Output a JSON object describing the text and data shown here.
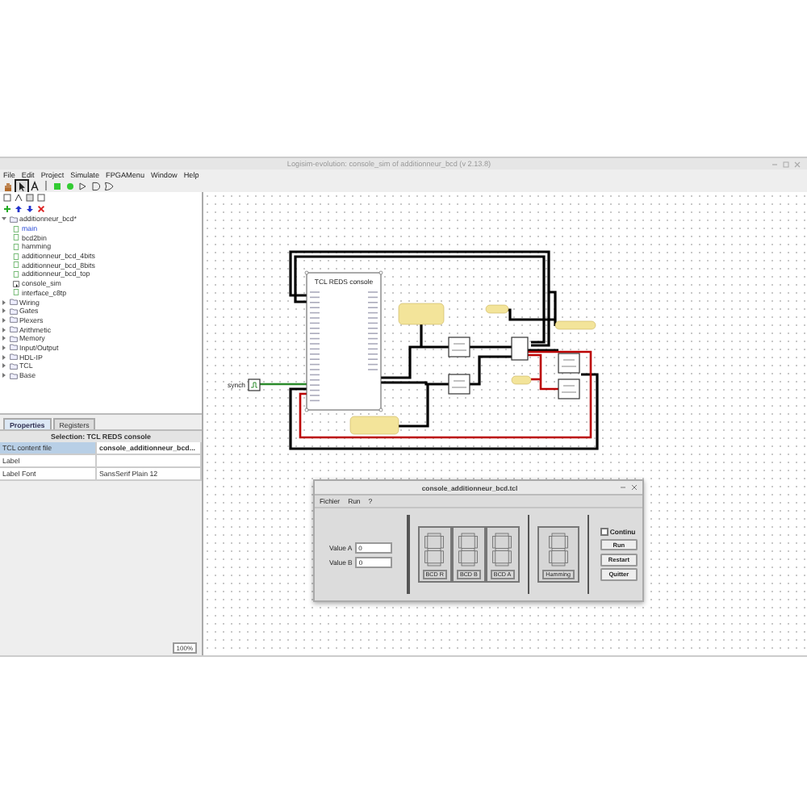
{
  "window": {
    "title": "Logisim-evolution: console_sim of additionneur_bcd (v 2.13.8)"
  },
  "menu": [
    "File",
    "Edit",
    "Project",
    "Simulate",
    "FPGAMenu",
    "Window",
    "Help"
  ],
  "tools": [
    {
      "kind": "hand",
      "selected": false
    },
    {
      "kind": "pointer",
      "selected": true
    },
    {
      "kind": "text",
      "selected": false
    },
    {
      "kind": "input",
      "selected": false
    },
    {
      "kind": "output",
      "selected": false
    },
    {
      "kind": "not",
      "selected": false
    },
    {
      "kind": "and",
      "selected": false
    },
    {
      "kind": "or",
      "selected": false
    }
  ],
  "tree": {
    "label": "additionneur_bcd*",
    "expanded": true,
    "children": [
      {
        "label": "main",
        "kind": "circuit",
        "selected": true
      },
      {
        "label": "bcd2bin",
        "kind": "circuit",
        "selected": false
      },
      {
        "label": "hamming",
        "kind": "circuit",
        "selected": false
      },
      {
        "label": "additionneur_bcd_4bits",
        "kind": "circuit",
        "selected": false
      },
      {
        "label": "additionneur_bcd_8bits",
        "kind": "circuit",
        "selected": false
      },
      {
        "label": "additionneur_bcd_top",
        "kind": "circuit",
        "selected": false
      },
      {
        "label": "console_sim",
        "kind": "sim",
        "selected": false
      },
      {
        "label": "interface_c8tp",
        "kind": "circuit",
        "selected": false
      }
    ]
  },
  "libraries": [
    {
      "label": "Wiring",
      "expanded": false
    },
    {
      "label": "Gates",
      "expanded": false
    },
    {
      "label": "Plexers",
      "expanded": false
    },
    {
      "label": "Arithmetic",
      "expanded": false
    },
    {
      "label": "Memory",
      "expanded": false
    },
    {
      "label": "Input/Output",
      "expanded": false
    },
    {
      "label": "HDL-IP",
      "expanded": false
    },
    {
      "label": "TCL",
      "expanded": false
    },
    {
      "label": "Base",
      "expanded": false
    }
  ],
  "properties": {
    "tabs": [
      {
        "label": "Properties",
        "selected": true
      },
      {
        "label": "Registers",
        "selected": false
      }
    ],
    "selection": "Selection: TCL REDS console",
    "rows": [
      {
        "name": "TCL content file",
        "value": "console_additionneur_bcd...",
        "selected": true
      },
      {
        "name": "Label",
        "selected": false
      },
      {
        "name": "Label Font",
        "value": "SansSerif Plain 12",
        "selected": false
      }
    ]
  },
  "zoom": "100%",
  "canvas": {
    "component_title": "TCL REDS console",
    "clock_label": "synch"
  },
  "console": {
    "title": "console_additionneur_bcd.tcl",
    "menu": [
      "Fichier",
      "Run",
      "?"
    ],
    "fields": [
      {
        "label": "Value A",
        "value": "0"
      },
      {
        "label": "Value B",
        "value": "0"
      }
    ],
    "displays": [
      {
        "label": "BCD R"
      },
      {
        "label": "BCD B"
      },
      {
        "label": "BCD A"
      }
    ],
    "hamming": {
      "label": "Hamming"
    },
    "checkbox": {
      "label": "Continu",
      "checked": false
    },
    "buttons": [
      "Run",
      "Restart",
      "Quitter"
    ]
  }
}
